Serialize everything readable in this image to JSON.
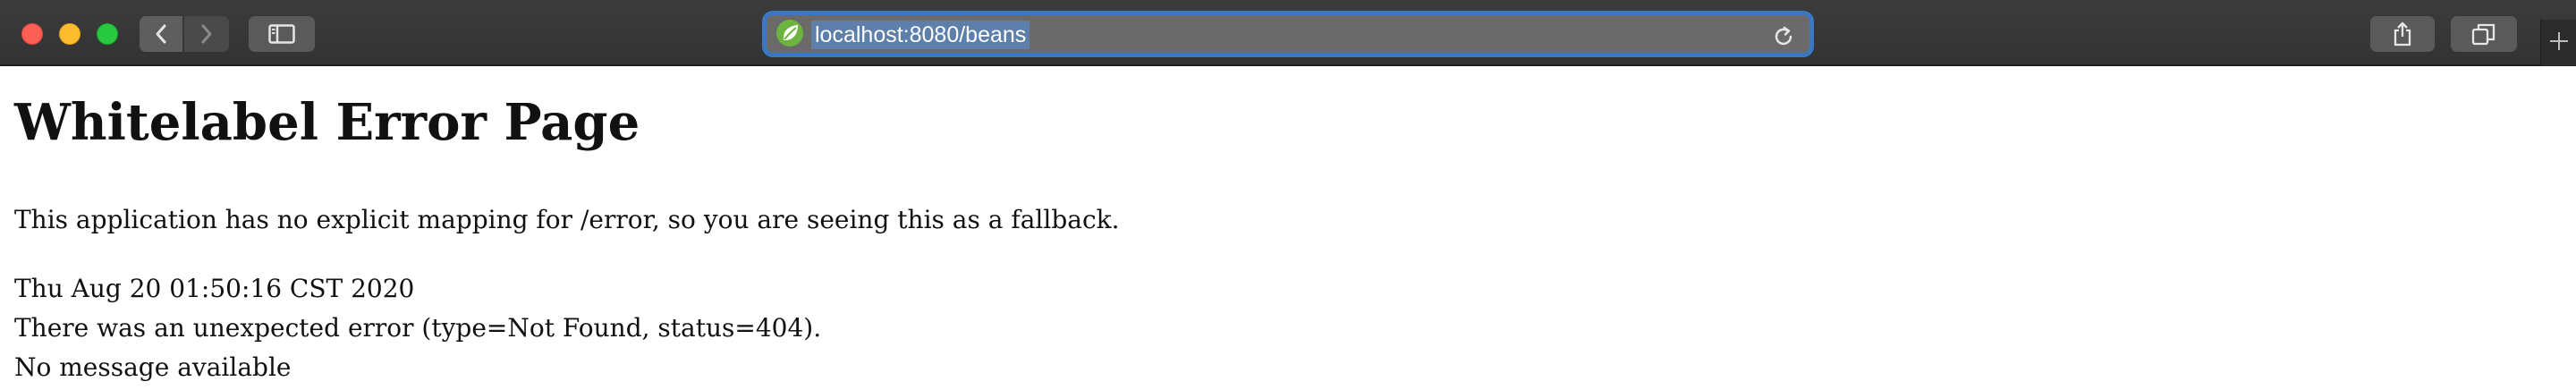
{
  "browser": {
    "url": "localhost:8080/beans",
    "favicon": "spring-leaf-icon",
    "colors": {
      "toolbar": "#383838",
      "url_focus_ring": "#3a78c3",
      "url_selection": "#5d7fa9",
      "favicon_green": "#6db33f"
    },
    "buttons": {
      "back": "chevron-left-icon",
      "forward": "chevron-right-icon",
      "sidebar": "sidebar-icon",
      "share": "share-icon",
      "tabs": "tab-overview-icon",
      "new_tab": "plus-icon",
      "reload": "reload-icon"
    }
  },
  "page": {
    "title": "Whitelabel Error Page",
    "message": "This application has no explicit mapping for /error, so you are seeing this as a fallback.",
    "timestamp": "Thu Aug 20 01:50:16 CST 2020",
    "error": "There was an unexpected error (type=Not Found, status=404).",
    "detail": "No message available"
  }
}
